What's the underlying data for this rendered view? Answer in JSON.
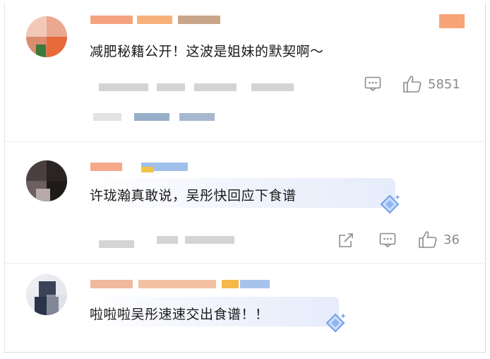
{
  "comments": [
    {
      "text": "减肥秘籍公开！这波是姐妹的默契啊～",
      "likes": "5851"
    },
    {
      "text": "许珑瀚真敢说，吴彤快回应下食谱",
      "likes": "36"
    },
    {
      "text": "啦啦啦吴彤速速交出食谱！！"
    }
  ],
  "icons": {
    "comment": "comment-icon",
    "like": "thumbs-up-icon",
    "share": "share-icon",
    "badge": "diamond-badge-icon"
  }
}
